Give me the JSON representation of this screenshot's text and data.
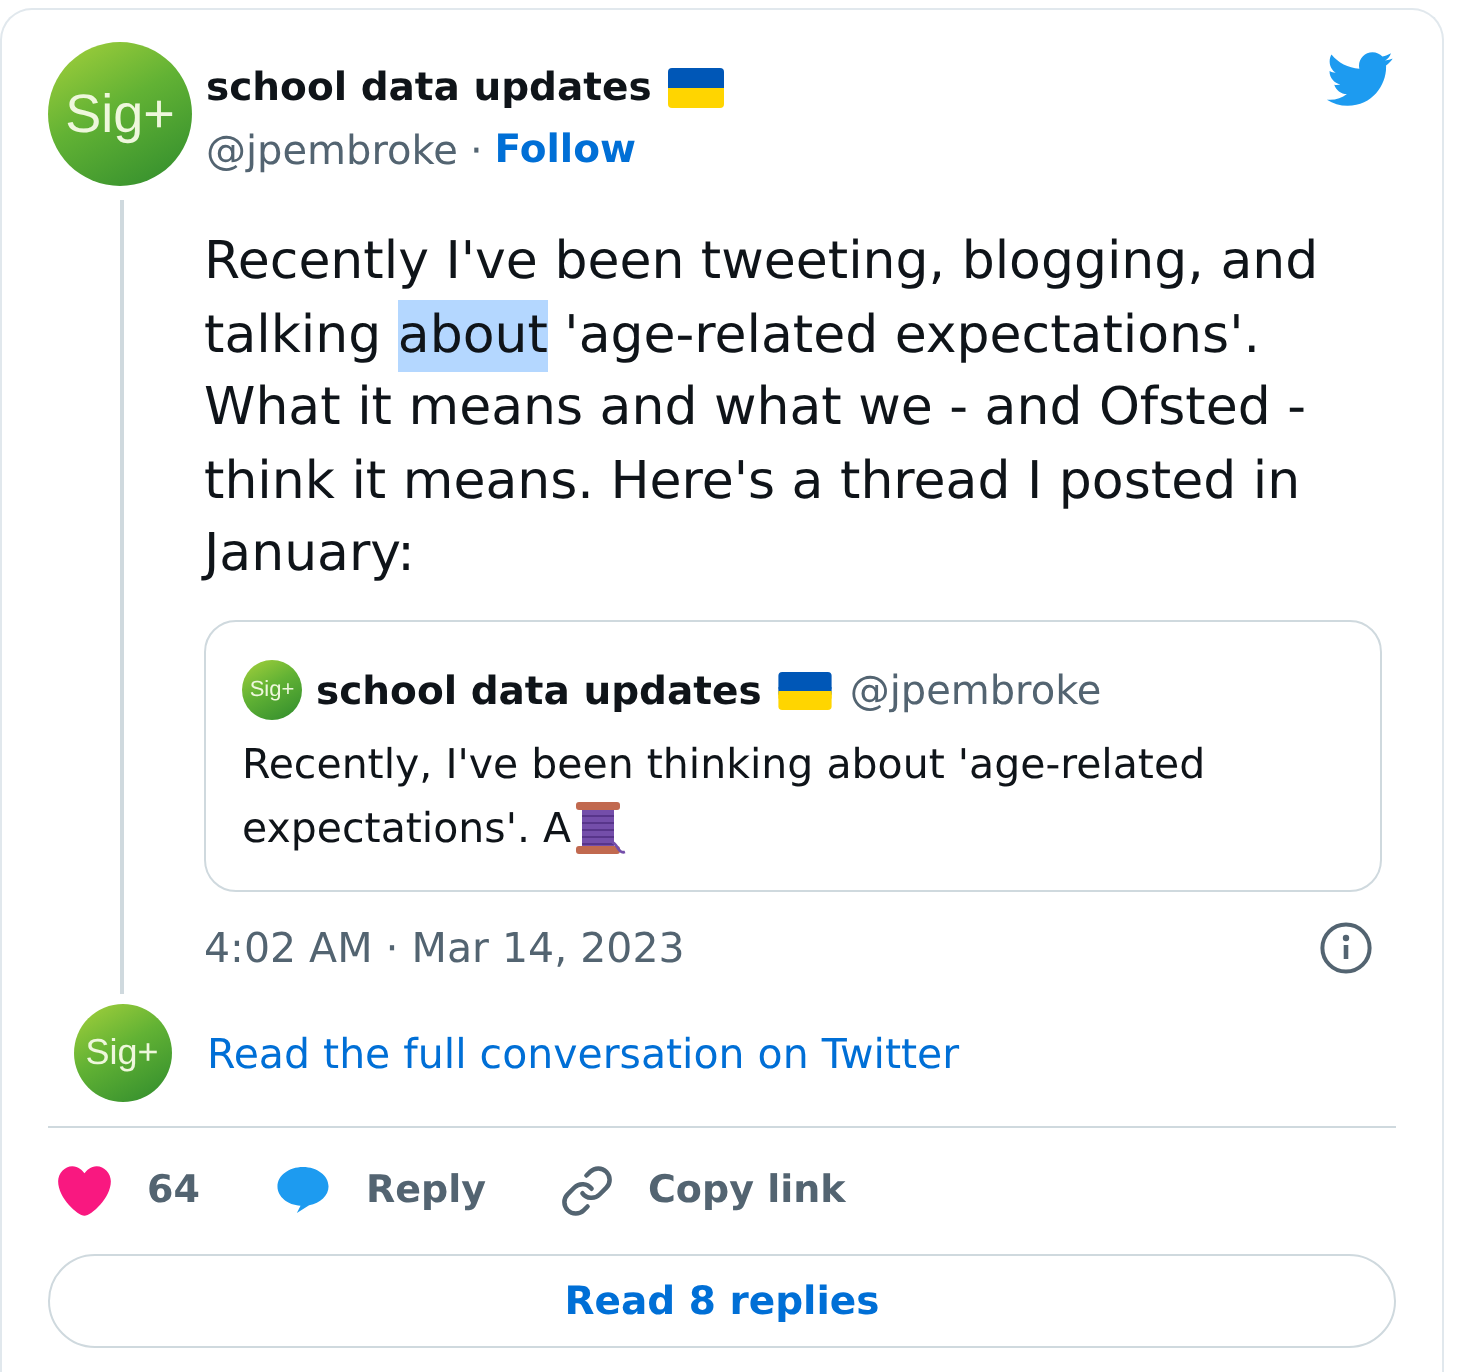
{
  "tweet": {
    "author": {
      "avatar_text": "Sig+",
      "name": "school data updates",
      "handle": "@jpembroke",
      "separator": "·",
      "follow": "Follow"
    },
    "text": [
      {
        "text": "Recently I've been tweeting, blogging, and talking ",
        "selected": false
      },
      {
        "text": "about",
        "selected": true
      },
      {
        "text": " 'age-related expectations'. What it means and what we - and Ofsted - think it means. Here's a thread I posted in January:",
        "selected": false
      }
    ],
    "quoted_tweet": {
      "avatar_text": "Sig+",
      "name": "school data updates",
      "handle": "@jpembroke",
      "text_lines": [
        "Recently, I've been thinking about 'age-related",
        "expectations'. A"
      ]
    },
    "timestamp": "4:02 AM · Mar 14, 2023",
    "conversation": {
      "avatar_text": "Sig+",
      "link": "Read the full conversation on Twitter"
    },
    "actions": [
      {
        "kind": "like",
        "label": "64"
      },
      {
        "kind": "reply",
        "label": "Reply"
      },
      {
        "kind": "copy_link",
        "label": "Copy link"
      }
    ],
    "replies_button": "Read 8 replies"
  }
}
